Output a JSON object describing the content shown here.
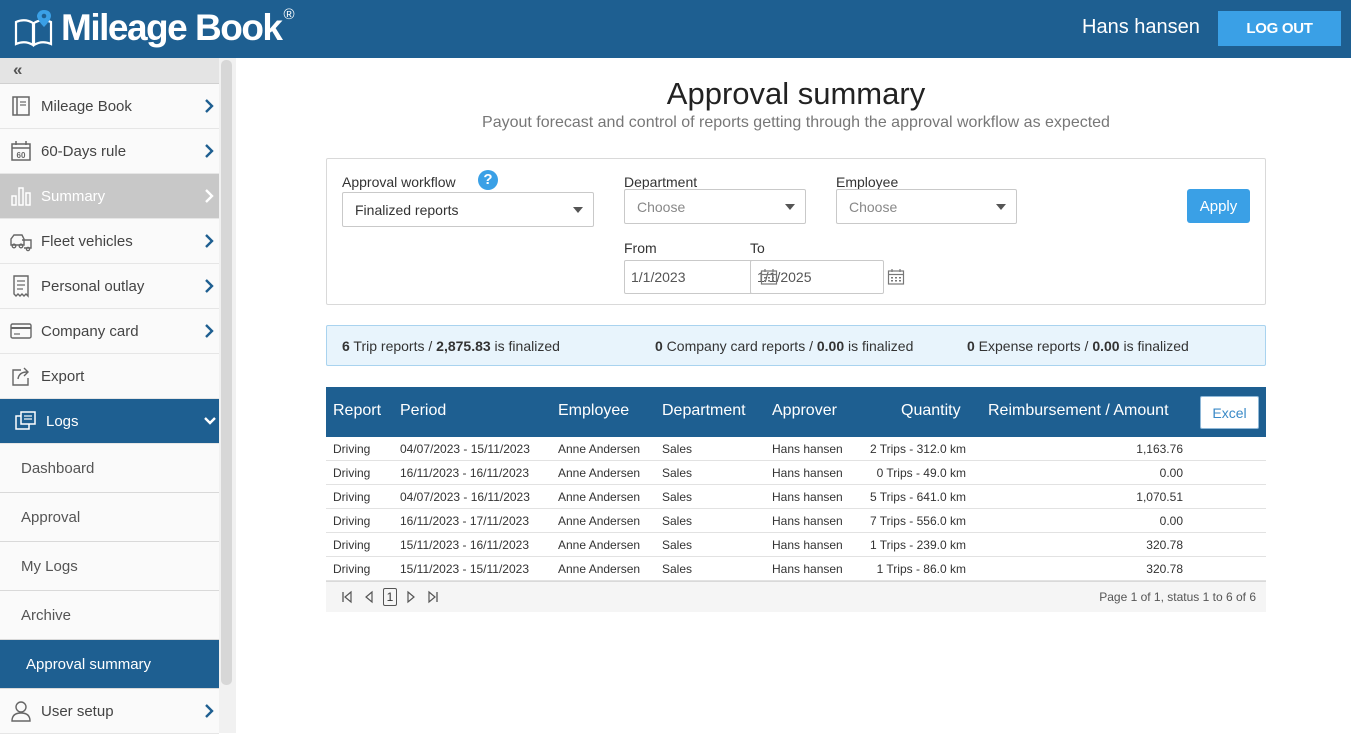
{
  "header": {
    "logo_text": "Mileage Book",
    "logo_reg": "®",
    "username": "Hans hansen",
    "logout_label": "LOG OUT",
    "brand_color": "#1e5f91",
    "accent_color": "#3aa0e6"
  },
  "sidebar": {
    "collapse_glyph": "«",
    "items": [
      {
        "label": "Mileage Book",
        "icon": "book-icon"
      },
      {
        "label": "60-Days rule",
        "icon": "calendar-60-icon"
      },
      {
        "label": "Summary",
        "icon": "bar-chart-icon"
      },
      {
        "label": "Fleet vehicles",
        "icon": "vehicles-icon"
      },
      {
        "label": "Personal outlay",
        "icon": "receipt-icon"
      },
      {
        "label": "Company card",
        "icon": "credit-card-icon"
      },
      {
        "label": "Export",
        "icon": "export-icon"
      },
      {
        "label": "Logs",
        "icon": "logs-icon"
      }
    ],
    "sub_items": [
      "Dashboard",
      "Approval",
      "My Logs",
      "Archive",
      "Approval summary"
    ],
    "bottom_item": {
      "label": "User setup",
      "icon": "user-icon"
    }
  },
  "page": {
    "title": "Approval summary",
    "subtitle": "Payout forecast and control of reports getting through the approval workflow as expected"
  },
  "filters": {
    "workflow_label": "Approval workflow",
    "workflow_value": "Finalized reports",
    "help_glyph": "?",
    "department_label": "Department",
    "department_value": "Choose",
    "employee_label": "Employee",
    "employee_value": "Choose",
    "apply_label": "Apply",
    "from_label": "From",
    "from_value": "1/1/2023",
    "to_label": "To",
    "to_value": "1/1/2025"
  },
  "summary": {
    "trip_count": "6",
    "trip_text": " Trip reports / ",
    "trip_amount": "2,875.83",
    "trip_suffix": " is finalized",
    "card_count": "0",
    "card_text": " Company card reports / ",
    "card_amount": "0.00",
    "card_suffix": " is finalized",
    "expense_count": "0",
    "expense_text": " Expense reports / ",
    "expense_amount": "0.00",
    "expense_suffix": " is finalized"
  },
  "table": {
    "columns": [
      "Report",
      "Period",
      "Employee",
      "Department",
      "Approver",
      "Quantity",
      "Reimbursement / Amount"
    ],
    "excel_label": "Excel",
    "rows": [
      {
        "report": "Driving",
        "period": "04/07/2023 - 15/11/2023",
        "employee": "Anne Andersen",
        "department": "Sales",
        "approver": "Hans hansen",
        "quantity": "2 Trips - 312.0 km",
        "amount": "1,163.76"
      },
      {
        "report": "Driving",
        "period": "16/11/2023 - 16/11/2023",
        "employee": "Anne Andersen",
        "department": "Sales",
        "approver": "Hans hansen",
        "quantity": "0 Trips - 49.0 km",
        "amount": "0.00"
      },
      {
        "report": "Driving",
        "period": "04/07/2023 - 16/11/2023",
        "employee": "Anne Andersen",
        "department": "Sales",
        "approver": "Hans hansen",
        "quantity": "5 Trips - 641.0 km",
        "amount": "1,070.51"
      },
      {
        "report": "Driving",
        "period": "16/11/2023 - 17/11/2023",
        "employee": "Anne Andersen",
        "department": "Sales",
        "approver": "Hans hansen",
        "quantity": "7 Trips - 556.0 km",
        "amount": "0.00"
      },
      {
        "report": "Driving",
        "period": "15/11/2023 - 16/11/2023",
        "employee": "Anne Andersen",
        "department": "Sales",
        "approver": "Hans hansen",
        "quantity": "1 Trips - 239.0 km",
        "amount": "320.78"
      },
      {
        "report": "Driving",
        "period": "15/11/2023 - 15/11/2023",
        "employee": "Anne Andersen",
        "department": "Sales",
        "approver": "Hans hansen",
        "quantity": "1 Trips - 86.0 km",
        "amount": "320.78"
      }
    ]
  },
  "pager": {
    "current_page": "1",
    "info": "Page 1 of 1, status 1 to 6 of 6"
  }
}
